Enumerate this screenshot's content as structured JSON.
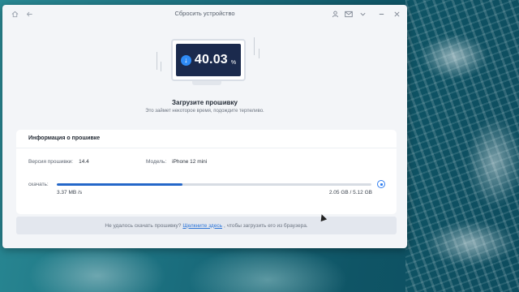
{
  "window": {
    "title": "Сбросить устройство"
  },
  "hero": {
    "percent": "40.03",
    "percent_sign": "%",
    "title": "Загрузите прошивку",
    "subtitle": "Это займет некоторое время, подождите терпеливо."
  },
  "firmware": {
    "heading": "Информация о прошивке",
    "version_label": "Версия прошивки:",
    "version_value": "14.4",
    "model_label": "Модель:",
    "model_value": "iPhone 12 mini",
    "download_label": "скачать:",
    "progress": 0.4003,
    "speed": "3.37 MB /s",
    "sizes": "2.05 GB / 5.12 GB"
  },
  "footer": {
    "text_before": "Не удалось скачать прошивку?",
    "link": "Щелкните здесь",
    "text_after": ", чтобы загрузить его из браузера."
  },
  "colors": {
    "accent": "#2467c9",
    "screen": "#1b2a4d",
    "badge": "#2f8bf5"
  },
  "icons": [
    "home-icon",
    "back-arrow-icon",
    "user-icon",
    "mail-icon",
    "chevron-down-icon",
    "minimize-icon",
    "close-icon",
    "download-icon",
    "pause-icon"
  ]
}
